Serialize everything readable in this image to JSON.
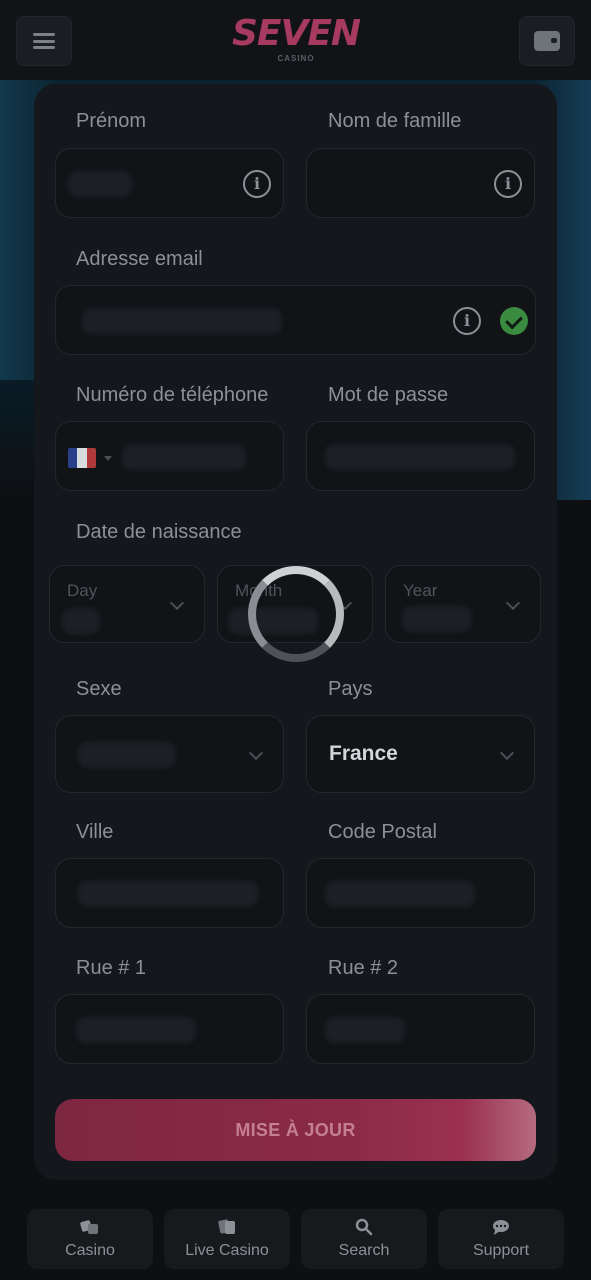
{
  "header": {
    "logo_text": "SEVEN",
    "logo_sub": "CASINO"
  },
  "form": {
    "first_name_label": "Prénom",
    "last_name_label": "Nom de famille",
    "email_label": "Adresse email",
    "phone_label": "Numéro de téléphone",
    "password_label": "Mot de passe",
    "dob_label": "Date de naissance",
    "dob_day": "Day",
    "dob_month": "Month",
    "dob_year": "Year",
    "sex_label": "Sexe",
    "country_label": "Pays",
    "country_value": "France",
    "city_label": "Ville",
    "postal_label": "Code Postal",
    "street1_label": "Rue # 1",
    "street2_label": "Rue # 2",
    "info_glyph": "i",
    "submit_label": "MISE À JOUR"
  },
  "icons": {
    "info": "info-icon",
    "valid": "check-circle-icon",
    "dropdown": "chevron-down-icon",
    "flag": "france-flag-icon"
  },
  "colors": {
    "accent": "#8a2a48",
    "valid": "#3a8a3f"
  },
  "bottom_nav": [
    {
      "label": "Casino",
      "icon": "dice-icon"
    },
    {
      "label": "Live Casino",
      "icon": "cards-icon"
    },
    {
      "label": "Search",
      "icon": "search-icon"
    },
    {
      "label": "Support",
      "icon": "chat-icon"
    }
  ]
}
